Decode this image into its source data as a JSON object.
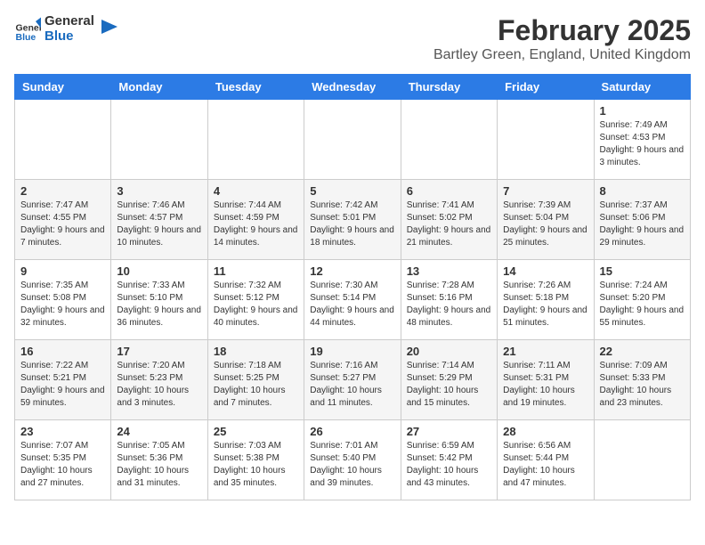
{
  "logo": {
    "line1": "General",
    "line2": "Blue"
  },
  "header": {
    "month": "February 2025",
    "location": "Bartley Green, England, United Kingdom"
  },
  "days_of_week": [
    "Sunday",
    "Monday",
    "Tuesday",
    "Wednesday",
    "Thursday",
    "Friday",
    "Saturday"
  ],
  "weeks": [
    [
      {
        "day": "",
        "detail": ""
      },
      {
        "day": "",
        "detail": ""
      },
      {
        "day": "",
        "detail": ""
      },
      {
        "day": "",
        "detail": ""
      },
      {
        "day": "",
        "detail": ""
      },
      {
        "day": "",
        "detail": ""
      },
      {
        "day": "1",
        "detail": "Sunrise: 7:49 AM\nSunset: 4:53 PM\nDaylight: 9 hours and 3 minutes."
      }
    ],
    [
      {
        "day": "2",
        "detail": "Sunrise: 7:47 AM\nSunset: 4:55 PM\nDaylight: 9 hours and 7 minutes."
      },
      {
        "day": "3",
        "detail": "Sunrise: 7:46 AM\nSunset: 4:57 PM\nDaylight: 9 hours and 10 minutes."
      },
      {
        "day": "4",
        "detail": "Sunrise: 7:44 AM\nSunset: 4:59 PM\nDaylight: 9 hours and 14 minutes."
      },
      {
        "day": "5",
        "detail": "Sunrise: 7:42 AM\nSunset: 5:01 PM\nDaylight: 9 hours and 18 minutes."
      },
      {
        "day": "6",
        "detail": "Sunrise: 7:41 AM\nSunset: 5:02 PM\nDaylight: 9 hours and 21 minutes."
      },
      {
        "day": "7",
        "detail": "Sunrise: 7:39 AM\nSunset: 5:04 PM\nDaylight: 9 hours and 25 minutes."
      },
      {
        "day": "8",
        "detail": "Sunrise: 7:37 AM\nSunset: 5:06 PM\nDaylight: 9 hours and 29 minutes."
      }
    ],
    [
      {
        "day": "9",
        "detail": "Sunrise: 7:35 AM\nSunset: 5:08 PM\nDaylight: 9 hours and 32 minutes."
      },
      {
        "day": "10",
        "detail": "Sunrise: 7:33 AM\nSunset: 5:10 PM\nDaylight: 9 hours and 36 minutes."
      },
      {
        "day": "11",
        "detail": "Sunrise: 7:32 AM\nSunset: 5:12 PM\nDaylight: 9 hours and 40 minutes."
      },
      {
        "day": "12",
        "detail": "Sunrise: 7:30 AM\nSunset: 5:14 PM\nDaylight: 9 hours and 44 minutes."
      },
      {
        "day": "13",
        "detail": "Sunrise: 7:28 AM\nSunset: 5:16 PM\nDaylight: 9 hours and 48 minutes."
      },
      {
        "day": "14",
        "detail": "Sunrise: 7:26 AM\nSunset: 5:18 PM\nDaylight: 9 hours and 51 minutes."
      },
      {
        "day": "15",
        "detail": "Sunrise: 7:24 AM\nSunset: 5:20 PM\nDaylight: 9 hours and 55 minutes."
      }
    ],
    [
      {
        "day": "16",
        "detail": "Sunrise: 7:22 AM\nSunset: 5:21 PM\nDaylight: 9 hours and 59 minutes."
      },
      {
        "day": "17",
        "detail": "Sunrise: 7:20 AM\nSunset: 5:23 PM\nDaylight: 10 hours and 3 minutes."
      },
      {
        "day": "18",
        "detail": "Sunrise: 7:18 AM\nSunset: 5:25 PM\nDaylight: 10 hours and 7 minutes."
      },
      {
        "day": "19",
        "detail": "Sunrise: 7:16 AM\nSunset: 5:27 PM\nDaylight: 10 hours and 11 minutes."
      },
      {
        "day": "20",
        "detail": "Sunrise: 7:14 AM\nSunset: 5:29 PM\nDaylight: 10 hours and 15 minutes."
      },
      {
        "day": "21",
        "detail": "Sunrise: 7:11 AM\nSunset: 5:31 PM\nDaylight: 10 hours and 19 minutes."
      },
      {
        "day": "22",
        "detail": "Sunrise: 7:09 AM\nSunset: 5:33 PM\nDaylight: 10 hours and 23 minutes."
      }
    ],
    [
      {
        "day": "23",
        "detail": "Sunrise: 7:07 AM\nSunset: 5:35 PM\nDaylight: 10 hours and 27 minutes."
      },
      {
        "day": "24",
        "detail": "Sunrise: 7:05 AM\nSunset: 5:36 PM\nDaylight: 10 hours and 31 minutes."
      },
      {
        "day": "25",
        "detail": "Sunrise: 7:03 AM\nSunset: 5:38 PM\nDaylight: 10 hours and 35 minutes."
      },
      {
        "day": "26",
        "detail": "Sunrise: 7:01 AM\nSunset: 5:40 PM\nDaylight: 10 hours and 39 minutes."
      },
      {
        "day": "27",
        "detail": "Sunrise: 6:59 AM\nSunset: 5:42 PM\nDaylight: 10 hours and 43 minutes."
      },
      {
        "day": "28",
        "detail": "Sunrise: 6:56 AM\nSunset: 5:44 PM\nDaylight: 10 hours and 47 minutes."
      },
      {
        "day": "",
        "detail": ""
      }
    ]
  ]
}
